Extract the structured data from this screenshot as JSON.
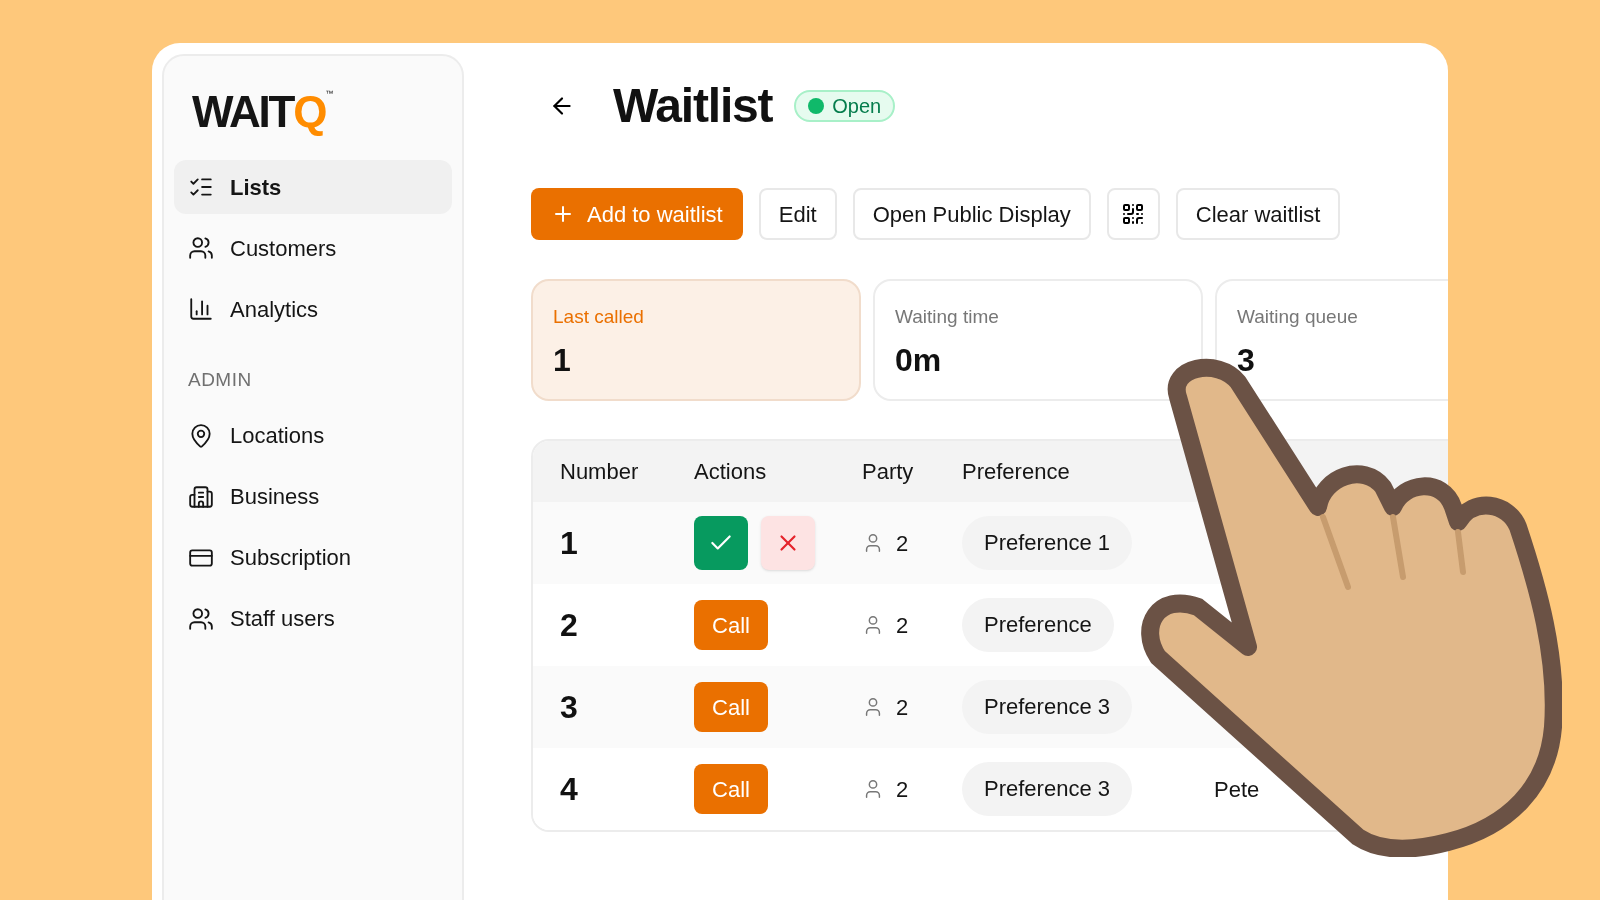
{
  "logo": {
    "text": "WAIT",
    "accent": "Q",
    "mark": "™"
  },
  "sidebar": {
    "items": [
      {
        "label": "Lists",
        "kind": "list",
        "selected": true
      },
      {
        "label": "Customers",
        "kind": "users",
        "selected": false
      },
      {
        "label": "Analytics",
        "kind": "chart",
        "selected": false
      }
    ],
    "admin_heading": "ADMIN",
    "admin_items": [
      {
        "label": "Locations",
        "kind": "pin",
        "selected": false
      },
      {
        "label": "Business",
        "kind": "building",
        "selected": false
      },
      {
        "label": "Subscription",
        "kind": "card",
        "selected": false
      },
      {
        "label": "Staff users",
        "kind": "users",
        "selected": false
      }
    ]
  },
  "header": {
    "title": "Waitlist",
    "status": "Open",
    "open": true
  },
  "toolbar": [
    {
      "kind": "primary",
      "label": "Add to waitlist"
    },
    {
      "kind": "plain",
      "label": "Edit"
    },
    {
      "kind": "plain",
      "label": "Open Public Display"
    },
    {
      "kind": "qr"
    },
    {
      "kind": "plain",
      "label": "Clear waitlist"
    }
  ],
  "stats": [
    {
      "label": "Last called",
      "value": "1",
      "highlight": true
    },
    {
      "label": "Waiting time",
      "value": "0m",
      "highlight": false
    },
    {
      "label": "Waiting queue",
      "value": "3",
      "highlight": false
    }
  ],
  "table": {
    "columns": [
      "Number",
      "Actions",
      "Party",
      "Preference"
    ],
    "rows": [
      {
        "number": "1",
        "action": {
          "kind": "confirm"
        },
        "party": "2",
        "preference": "Preference 1"
      },
      {
        "number": "2",
        "action": {
          "kind": "call",
          "label": "Call"
        },
        "party": "2",
        "preference": "Preference"
      },
      {
        "number": "3",
        "action": {
          "kind": "call",
          "label": "Call"
        },
        "party": "2",
        "preference": "Preference 3"
      },
      {
        "number": "4",
        "action": {
          "kind": "call",
          "label": "Call"
        },
        "party": "2",
        "preference": "Preference 3",
        "column_5": "Pete"
      }
    ]
  }
}
